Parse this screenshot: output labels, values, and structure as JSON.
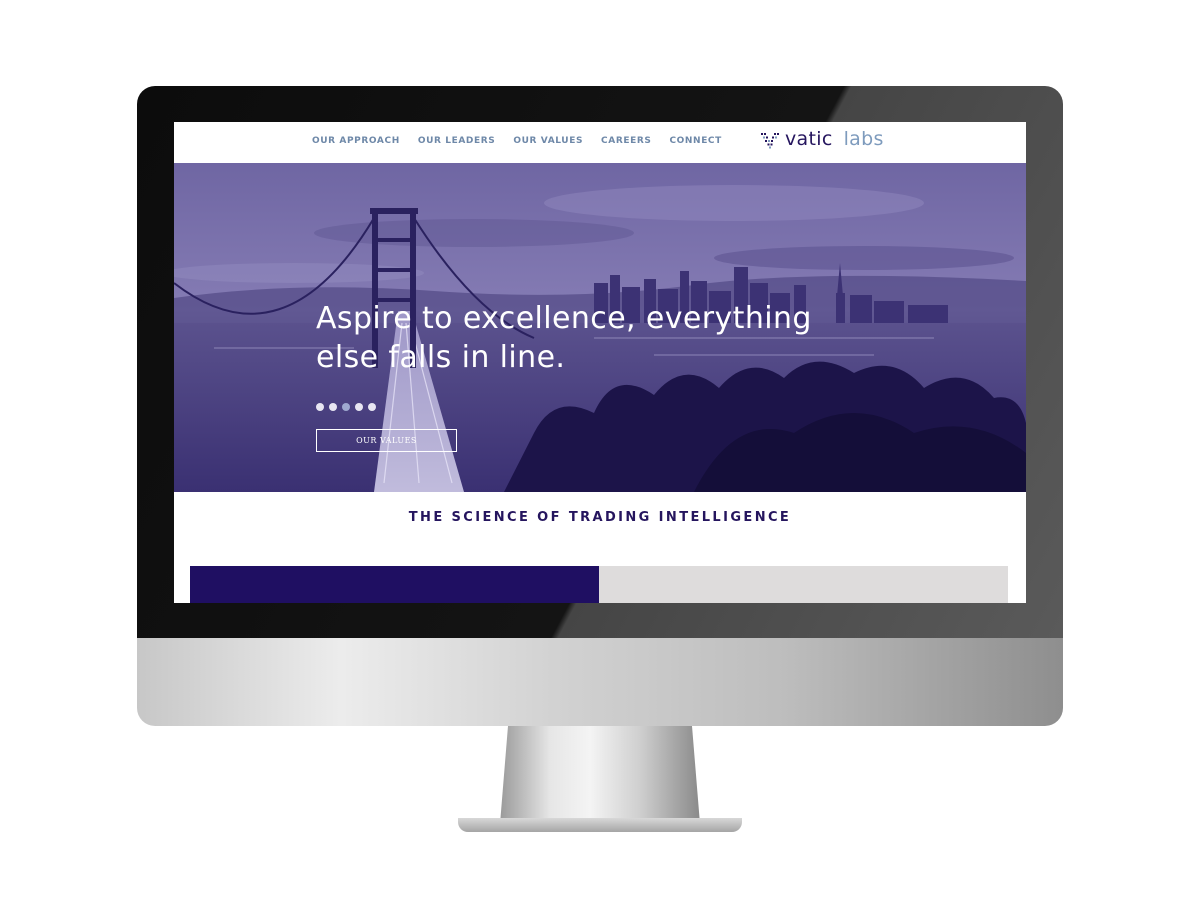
{
  "colors": {
    "brand_dark": "#25155e",
    "brand_light": "#7e9bbd",
    "hero_overlay": "#5b5290",
    "panel_primary": "#1f0f62",
    "panel_secondary": "#dedcdc"
  },
  "nav": {
    "items": [
      {
        "label": "OUR APPROACH"
      },
      {
        "label": "OUR LEADERS"
      },
      {
        "label": "OUR VALUES"
      },
      {
        "label": "CAREERS"
      },
      {
        "label": "CONNECT"
      }
    ]
  },
  "logo": {
    "icon": "vatic-labs-logo-icon",
    "part1": "vatic",
    "part2": "labs"
  },
  "hero": {
    "headline_line1": "Aspire to excellence, everything",
    "headline_line2": "else falls in line.",
    "carousel": {
      "total_slides": 5,
      "active_slide": 3
    },
    "cta_label": "OUR VALUES"
  },
  "section": {
    "tagline": "THE SCIENCE OF TRADING INTELLIGENCE"
  }
}
